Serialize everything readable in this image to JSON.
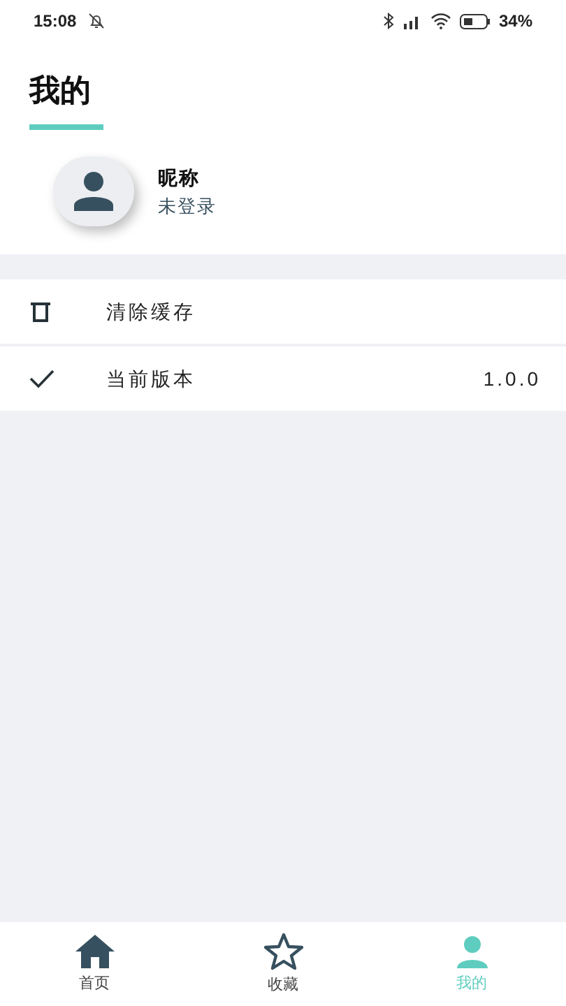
{
  "status_bar": {
    "time": "15:08",
    "battery": "34%"
  },
  "page_title": "我的",
  "profile": {
    "nickname": "昵称",
    "status": "未登录"
  },
  "menu": [
    {
      "kind": "trash",
      "label": "清除缓存"
    },
    {
      "kind": "check",
      "label": "当前版本",
      "value": "1.0.0"
    }
  ],
  "bottom_nav": [
    {
      "kind": "home",
      "label": "首页",
      "selected": false
    },
    {
      "kind": "star",
      "label": "收藏",
      "selected": false
    },
    {
      "kind": "person",
      "label": "我的",
      "selected": true
    }
  ]
}
